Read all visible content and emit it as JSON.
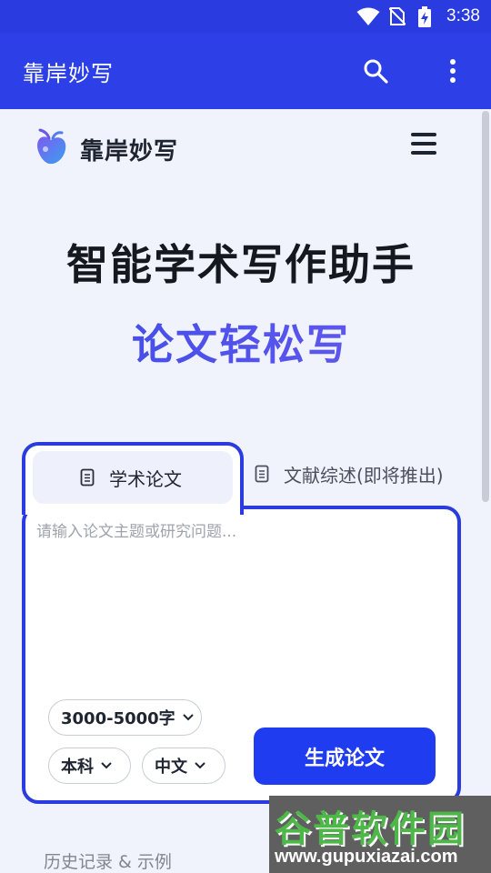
{
  "status_bar": {
    "time": "3:38"
  },
  "app_bar": {
    "title": "靠岸妙写"
  },
  "brand": {
    "name": "靠岸妙写"
  },
  "hero": {
    "headline": "智能学术写作助手",
    "subline": "论文轻松写"
  },
  "tabs": [
    {
      "label": "学术论文",
      "active": true
    },
    {
      "label": "文献综述(即将推出)",
      "active": false
    }
  ],
  "topic": {
    "placeholder": "请输入论文主题或研究问题...",
    "value": ""
  },
  "options": {
    "length": "3000-5000字",
    "level": "本科",
    "language": "中文"
  },
  "generate_label": "生成论文",
  "history_label": "历史记录 & 示例",
  "watermark": {
    "title": "谷普软件园",
    "url": "www.gupuxiazai.com"
  },
  "colors": {
    "primary": "#2d40e8",
    "button": "#1f3cf0",
    "background": "#f0f3fc",
    "watermark_green": "#4db848"
  }
}
